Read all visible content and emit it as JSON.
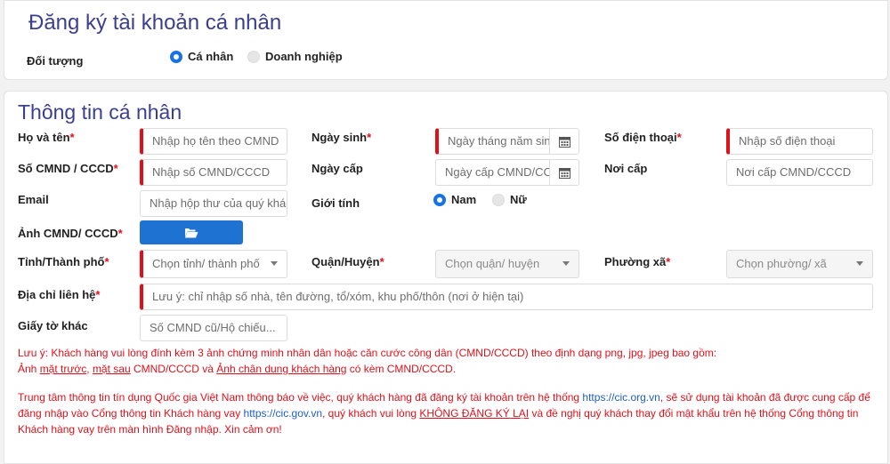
{
  "section1": {
    "title": "Đăng ký tài khoản cá nhân",
    "doi_tuong_label": "Đối tượng",
    "options": [
      {
        "label": "Cá nhân",
        "selected": true
      },
      {
        "label": "Doanh nghiệp",
        "selected": false
      }
    ]
  },
  "section2": {
    "title": "Thông tin cá nhân",
    "fields": {
      "ho_ten": {
        "label": "Họ và tên",
        "placeholder": "Nhập họ tên theo CMND"
      },
      "ngay_sinh": {
        "label": "Ngày sinh",
        "placeholder": "Ngày tháng năm sinh"
      },
      "so_dien_thoai": {
        "label": "Số điện thoại",
        "placeholder": "Nhập số điện thoại"
      },
      "so_cmnd": {
        "label": "Số CMND / CCCD",
        "placeholder": "Nhập số CMND/CCCD"
      },
      "ngay_cap": {
        "label": "Ngày cấp",
        "placeholder": "Ngày cấp CMND/CCCD"
      },
      "noi_cap": {
        "label": "Nơi cấp",
        "placeholder": "Nơi cấp CMND/CCCD"
      },
      "email": {
        "label": "Email",
        "placeholder": "Nhập hộp thư của quý khách"
      },
      "gioi_tinh": {
        "label": "Giới tính",
        "options": [
          {
            "label": "Nam",
            "selected": true
          },
          {
            "label": "Nữ",
            "selected": false
          }
        ]
      },
      "anh_cmnd": {
        "label": "Ảnh CMND/ CCCD",
        "icon": "folder-open-icon"
      },
      "tinh": {
        "label": "Tỉnh/Thành phố",
        "placeholder": "Chọn tỉnh/ thành phố"
      },
      "quan": {
        "label": "Quận/Huyện",
        "placeholder": "Chọn quận/ huyện"
      },
      "phuong": {
        "label": "Phường xã",
        "placeholder": "Chọn phường/ xã"
      },
      "dia_chi": {
        "label": "Địa chỉ liên hệ",
        "placeholder": "Lưu ý: chỉ nhập số nhà, tên đường, tổ/xóm, khu phố/thôn (nơi ở hiện tại)"
      },
      "giay_to_khac": {
        "label": "Giấy tờ khác",
        "placeholder": "Số CMND cũ/Hộ chiếu..."
      }
    },
    "required_mark": "*",
    "note1": {
      "line1": "Lưu ý: Khách hàng vui lòng đính kèm 3 ảnh chứng minh nhân dân hoặc căn cước công dân (CMND/CCCD) theo định dạng png, jpg, jpeg bao gồm:",
      "line2_a": "Ảnh ",
      "mat_truoc": "mặt trước",
      "comma": ", ",
      "mat_sau": "mặt sau",
      "line2_b": " CMND/CCCD và ",
      "chan_dung": "Ảnh chân dung khách hàng",
      "line2_c": " có kèm CMND/CCCD."
    },
    "note2": {
      "p1": "Trung tâm thông tin tín dụng Quốc gia Việt Nam thông báo về việc, quý khách hàng đã đăng ký tài khoản trên hệ thống ",
      "link1": "https://cic.org.vn",
      "p2": ", sẽ sử dụng tài khoản đã được cung cấp để đăng nhập vào Cổng thông tin Khách hàng vay ",
      "link2": "https://cic.gov.vn",
      "p3": ", quý khách vui lòng ",
      "khong_dang_ky": "KHÔNG ĐĂNG KÝ LẠI",
      "p4": " và đề nghị quý khách thay đổi mật khẩu trên hệ thống Cổng thông tin Khách hàng vay trên màn hình Đăng nhập. Xin cảm ơn!"
    }
  },
  "colors": {
    "title": "#3a3f8f",
    "required": "#e0101a",
    "accent": "#1e73d2",
    "link": "#1f5fc7"
  }
}
